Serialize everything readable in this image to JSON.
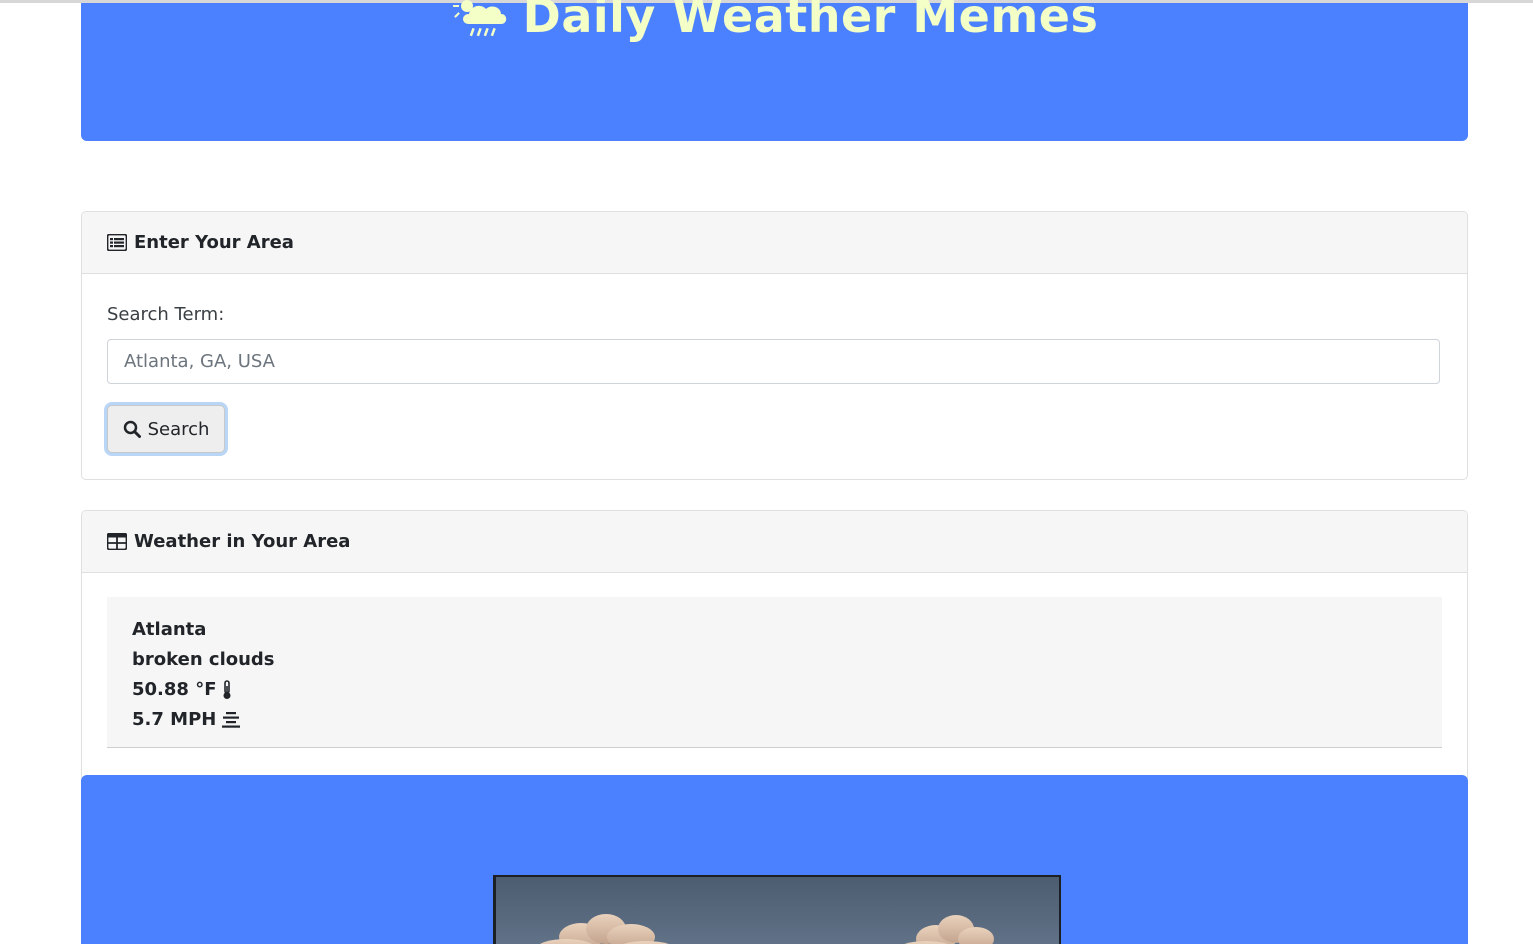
{
  "header": {
    "title": "Daily Weather Memes",
    "icon": "sun-cloud-rain-icon",
    "background_color": "#4b80ff",
    "title_color": "#f3ffc6"
  },
  "search_card": {
    "heading": "Enter Your Area",
    "heading_icon": "list-alt-icon",
    "label": "Search Term:",
    "input_placeholder": "Atlanta, GA, USA",
    "input_value": "",
    "button_label": "Search",
    "button_icon": "search-icon"
  },
  "weather_card": {
    "heading": "Weather in Your Area",
    "heading_icon": "table-icon",
    "city": "Atlanta",
    "description": "broken clouds",
    "temperature": "50.88 °F",
    "temperature_icon": "thermometer-icon",
    "wind": "5.7 MPH",
    "wind_icon": "wind-icon"
  },
  "meme": {
    "image": "clouds-photo",
    "panel_color": "#4b80ff"
  }
}
